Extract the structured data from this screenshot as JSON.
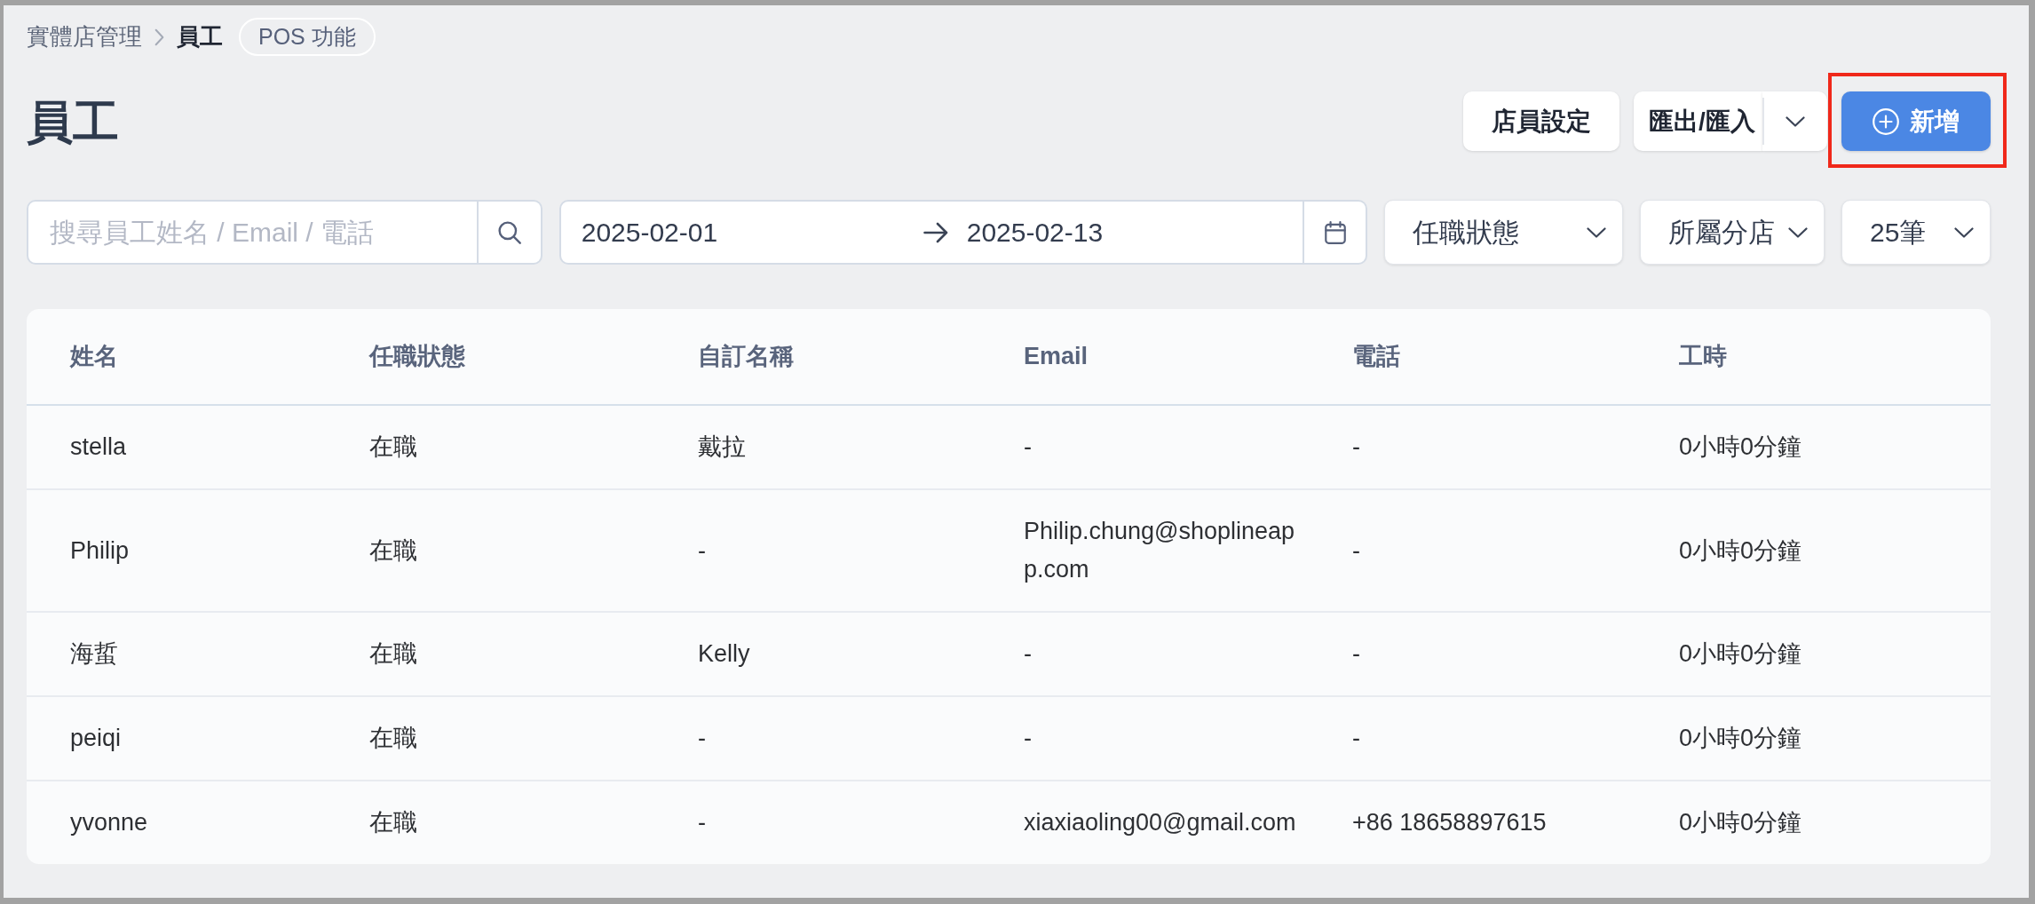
{
  "breadcrumb": {
    "items": [
      {
        "label": "實體店管理",
        "current": false
      },
      {
        "label": "員工",
        "current": true
      }
    ],
    "badge": "POS 功能"
  },
  "title": "員工",
  "actions": [
    {
      "kind": "button",
      "label": "店員設定",
      "highlighted": false
    },
    {
      "kind": "split",
      "label": "匯出/匯入",
      "highlighted": false
    },
    {
      "kind": "primary",
      "label": "新增",
      "highlighted": true
    }
  ],
  "filters": {
    "search": {
      "placeholder": "搜尋員工姓名 / Email / 電話"
    },
    "date_range": {
      "start": "2025-02-01",
      "end": "2025-02-13"
    },
    "dropdowns": [
      {
        "label": "任職狀態"
      },
      {
        "label": "所屬分店"
      },
      {
        "label": "25筆"
      }
    ]
  },
  "table": {
    "columns": [
      "姓名",
      "任職狀態",
      "自訂名稱",
      "Email",
      "電話",
      "工時"
    ],
    "rows": [
      [
        "stella",
        "在職",
        "戴拉",
        "-",
        "-",
        "0小時0分鐘"
      ],
      [
        "Philip",
        "在職",
        "-",
        "Philip.chung@shoplineapp.com",
        "-",
        "0小時0分鐘"
      ],
      [
        "海蜇",
        "在職",
        "Kelly",
        "-",
        "-",
        "0小時0分鐘"
      ],
      [
        "peiqi",
        "在職",
        "-",
        "-",
        "-",
        "0小時0分鐘"
      ],
      [
        "yvonne",
        "在職",
        "-",
        "xiaxiaoling00@gmail.com",
        "+86 18658897615",
        "0小時0分鐘"
      ]
    ]
  }
}
